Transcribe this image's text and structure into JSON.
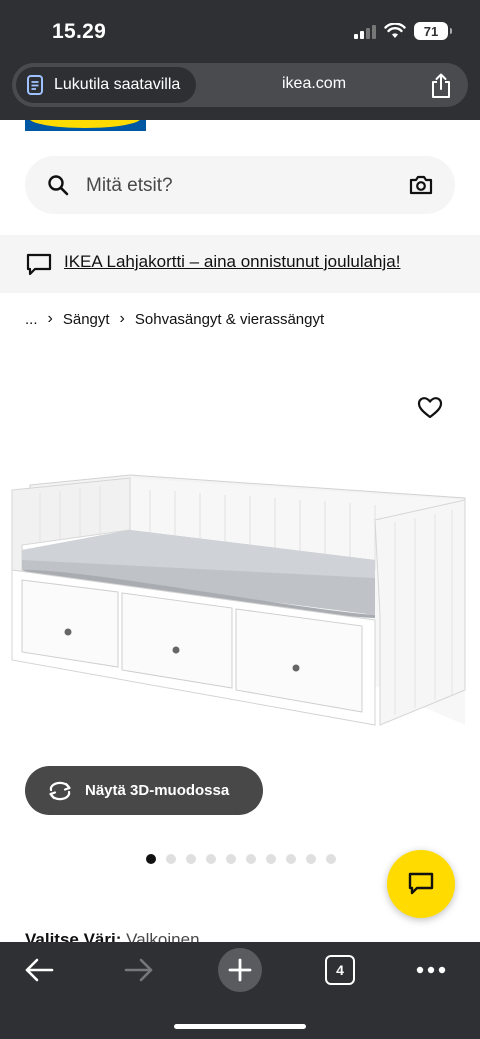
{
  "status": {
    "time": "15.29",
    "battery": "71"
  },
  "browser": {
    "reader_label": "Lukutila saatavilla",
    "domain": "ikea.com",
    "tabs_count": "4"
  },
  "search": {
    "placeholder": "Mitä etsit?"
  },
  "promo": {
    "text": "IKEA Lahjakortti – aina onnistunut joululahja!"
  },
  "breadcrumb": {
    "ellipsis": "...",
    "items": [
      "Sängyt",
      "Sohvasängyt & vierassängyt"
    ]
  },
  "product": {
    "view_3d_label": "Näytä 3D-muodossa",
    "carousel": {
      "total": 10,
      "active": 1
    },
    "color_label": "Valitse Väri:",
    "color_value": "Valkoinen"
  },
  "colors": {
    "ikea_blue": "#0058a3",
    "ikea_yellow": "#ffdb00",
    "chrome": "#2f3033"
  }
}
